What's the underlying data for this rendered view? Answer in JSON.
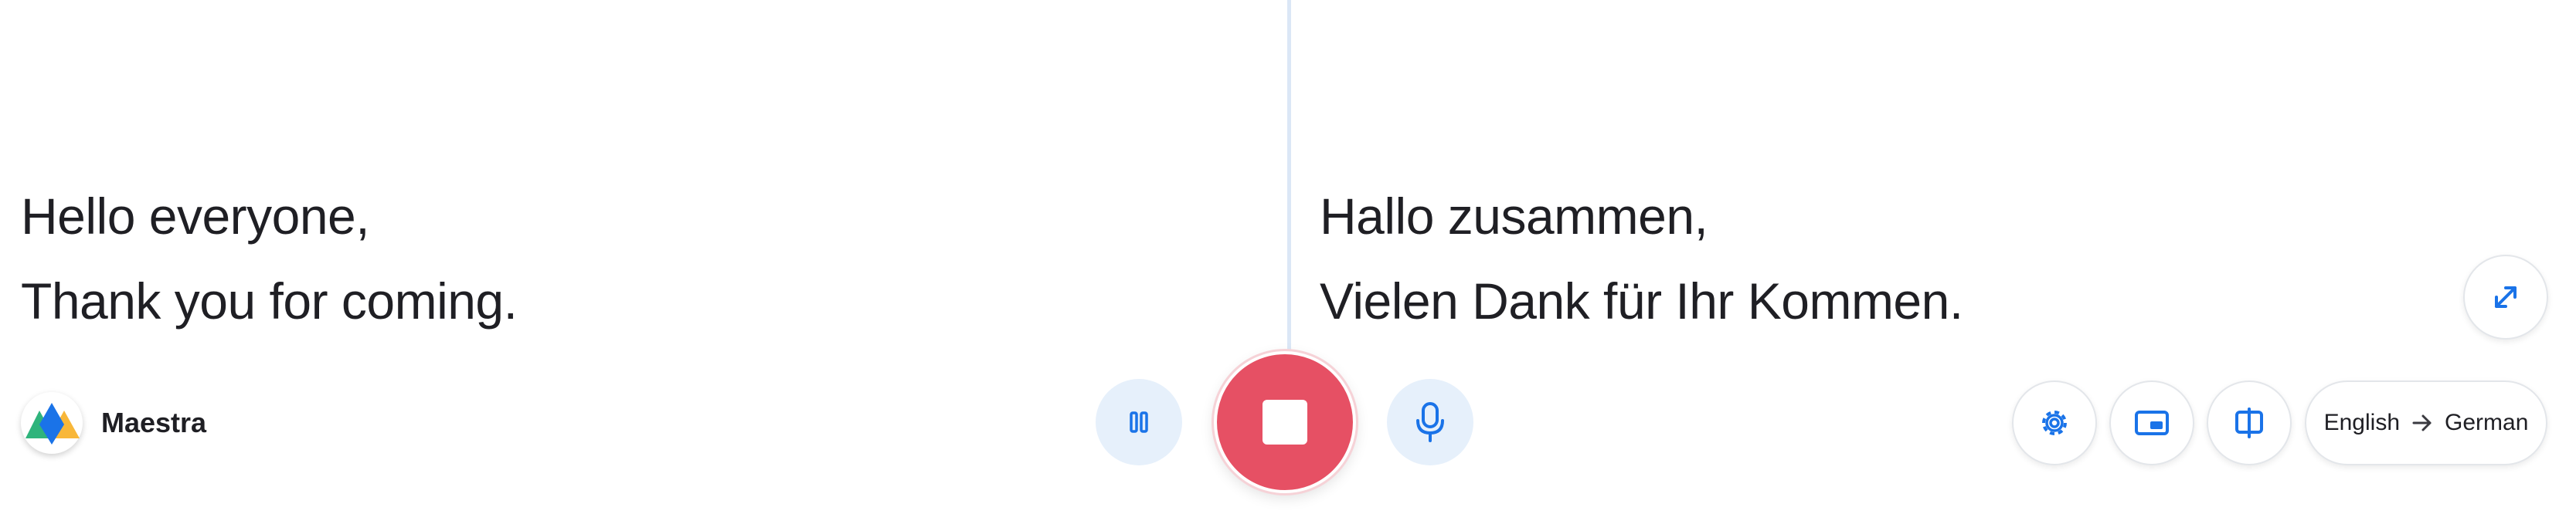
{
  "transcript": {
    "source_lines": [
      "Hello everyone,",
      "Thank you for coming."
    ],
    "target_lines": [
      "Hallo zusammen,",
      "Vielen Dank für Ihr Kommen."
    ]
  },
  "brand": {
    "name": "Maestra"
  },
  "controls": {
    "pause_icon": "pause-icon",
    "stop_icon": "stop-icon",
    "mic_icon": "microphone-icon",
    "settings_icon": "gear-icon",
    "pip_icon": "picture-in-picture-icon",
    "split_icon": "split-view-icon",
    "expand_icon": "expand-icon"
  },
  "language": {
    "source": "English",
    "target": "German"
  },
  "colors": {
    "accent": "#1a73e8",
    "stop": "#e65064",
    "soft_blue": "#e6f0fb",
    "divider": "#dbe7f6"
  }
}
